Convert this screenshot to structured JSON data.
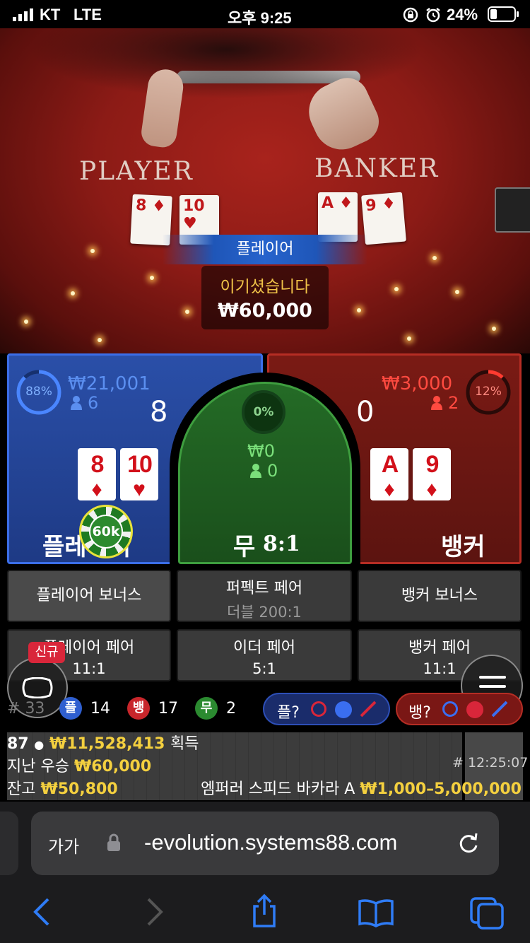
{
  "status_bar": {
    "carrier": "KT",
    "network": "LTE",
    "time": "오후 9:25",
    "battery": "24%"
  },
  "video": {
    "player_label": "PLAYER",
    "banker_label": "BANKER",
    "player_cards": [
      {
        "rank": "8",
        "suit": "♦"
      },
      {
        "rank": "10",
        "suit": "♥"
      }
    ],
    "banker_cards": [
      {
        "rank": "A",
        "suit": "♦"
      },
      {
        "rank": "9",
        "suit": "♦"
      }
    ]
  },
  "result": {
    "winner": "플레이어",
    "message": "이기셨습니다",
    "amount": "₩60,000"
  },
  "player_panel": {
    "percent": "88%",
    "total_bet": "₩21,001",
    "bettors": "6",
    "score": "8",
    "label": "플레이어",
    "chip": "60k",
    "cards": [
      {
        "rank": "8",
        "suit": "♦"
      },
      {
        "rank": "10",
        "suit": "♥"
      }
    ]
  },
  "tie_panel": {
    "percent": "0%",
    "total_bet": "₩0",
    "bettors": "0",
    "label": "무",
    "payout": "8:1"
  },
  "banker_panel": {
    "percent": "12%",
    "total_bet": "₩3,000",
    "bettors": "2",
    "score": "0",
    "label": "뱅커",
    "cards": [
      {
        "rank": "A",
        "suit": "♦"
      },
      {
        "rank": "9",
        "suit": "♦"
      }
    ]
  },
  "side_bets": {
    "player_bonus": "플레이어 보너스",
    "perfect_pair": "퍼펙트 페어",
    "perfect_pair_payout": "더블 200:1",
    "banker_bonus": "뱅커 보너스",
    "player_pair": "플레이어 페어",
    "player_pair_payout": "11:1",
    "either_pair": "이더 페어",
    "either_pair_payout": "5:1",
    "banker_pair": "뱅커 페어",
    "banker_pair_payout": "11:1"
  },
  "new_badge": "신규",
  "stats": {
    "round_prefix": "#",
    "round": "33",
    "player_short": "플",
    "player_count": "14",
    "banker_short": "뱅",
    "banker_count": "17",
    "tie_short": "무",
    "tie_count": "2",
    "player_predict": "플?",
    "banker_predict": "뱅?"
  },
  "footer": {
    "winners_count": "87",
    "winners_amount": "₩11,528,413",
    "winners_suffix": "획득",
    "last_win_label": "지난 우승",
    "last_win_amount": "₩60,000",
    "balance_label": "잔고",
    "balance_amount": "₩50,800",
    "game_name": "엠퍼러 스피드 바카라 A",
    "limits": "₩1,000–5,000,000",
    "round_time": "# 12:25:07"
  },
  "browser": {
    "text_size": "가가",
    "url": "-evolution.systems88.com"
  },
  "colors": {
    "player_blue": "#1e3f8c",
    "banker_red": "#6e1712",
    "tie_green": "#1d5a1e",
    "gold": "#f4d03f"
  }
}
